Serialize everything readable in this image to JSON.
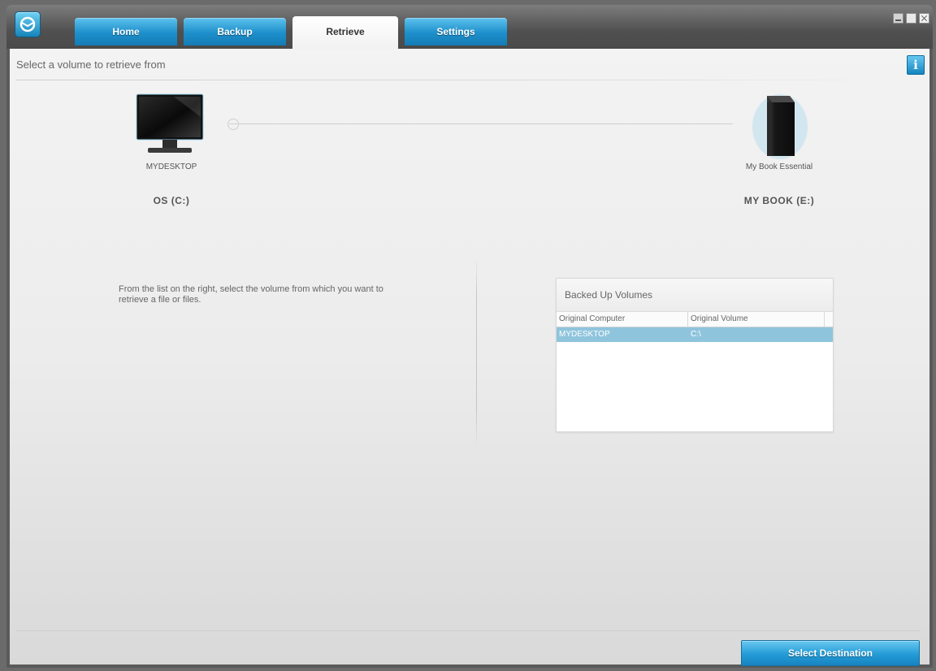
{
  "tabs": [
    {
      "label": "Home",
      "active": false
    },
    {
      "label": "Backup",
      "active": false
    },
    {
      "label": "Retrieve",
      "active": true
    },
    {
      "label": "Settings",
      "active": false
    }
  ],
  "header": {
    "title": "Select a volume to retrieve from",
    "info_icon": "info-icon"
  },
  "source": {
    "computer_name": "MYDESKTOP",
    "volume": "OS (C:)",
    "icon": "monitor-icon"
  },
  "destination": {
    "drive_name": "My Book Essential",
    "volume": "MY BOOK (E:)",
    "icon": "hard-drive-icon"
  },
  "instructions": "From the list on the right, select the volume from which you want to retrieve a file or files.",
  "volumes_panel": {
    "title": "Backed Up Volumes",
    "columns": [
      "Original Computer",
      "Original Volume"
    ],
    "rows": [
      {
        "computer": "MYDESKTOP",
        "volume": "C:\\",
        "selected": true
      }
    ]
  },
  "footer": {
    "select_destination_label": "Select Destination"
  },
  "colors": {
    "accent": "#239bd6",
    "selected_row": "#8fc4dd"
  }
}
